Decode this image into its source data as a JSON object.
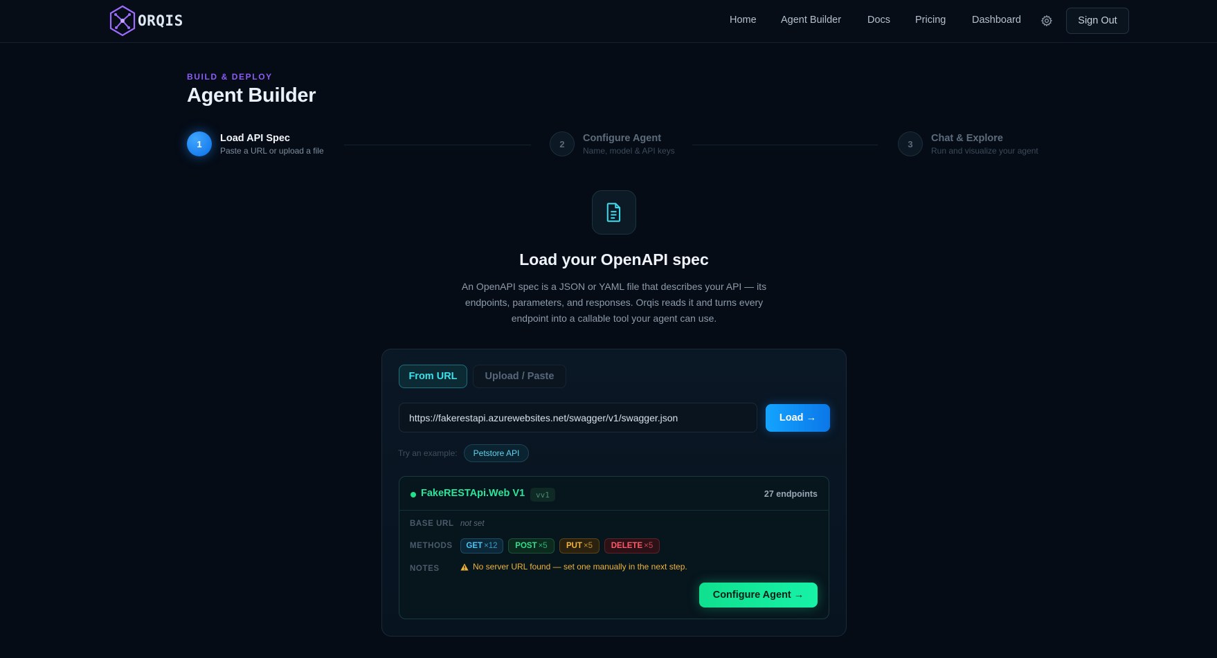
{
  "nav": {
    "brand": "ORQIS",
    "links": [
      "Home",
      "Agent Builder",
      "Docs",
      "Pricing",
      "Dashboard"
    ],
    "sign_out": "Sign Out"
  },
  "header": {
    "eyebrow": "BUILD & DEPLOY",
    "title": "Agent Builder"
  },
  "steps": [
    {
      "number": "1",
      "title": "Load API Spec",
      "subtitle": "Paste a URL or upload a file",
      "state": "active"
    },
    {
      "number": "2",
      "title": "Configure Agent",
      "subtitle": "Name, model & API keys",
      "state": "pending"
    },
    {
      "number": "3",
      "title": "Chat & Explore",
      "subtitle": "Run and visualize your agent",
      "state": "pending"
    }
  ],
  "hero": {
    "icon": "document-icon",
    "title": "Load your OpenAPI spec",
    "description": "An OpenAPI spec is a JSON or YAML file that describes your API — its endpoints, parameters, and responses. Orqis reads it and turns every endpoint into a callable tool your agent can use."
  },
  "loader": {
    "tabs": [
      "From URL",
      "Upload / Paste"
    ],
    "active_tab": "From URL",
    "url_value": "https://fakerestapi.azurewebsites.net/swagger/v1/swagger.json",
    "load_button": "Load →",
    "example_label": "Try an example:",
    "example_chip": "Petstore API"
  },
  "result": {
    "api_name": "FakeRESTApi.Web V1",
    "version": "vv1",
    "endpoint_count": "27 endpoints",
    "base_url_label": "BASE URL",
    "base_url_value": "not set",
    "methods_label": "METHODS",
    "methods": [
      {
        "name": "GET",
        "count": "×12"
      },
      {
        "name": "POST",
        "count": "×5"
      },
      {
        "name": "PUT",
        "count": "×5"
      },
      {
        "name": "DELETE",
        "count": "×5"
      }
    ],
    "notes_label": "NOTES",
    "note": "No server URL found — set one manually in the next step.",
    "configure_button": "Configure Agent →"
  },
  "colors": {
    "background": "#050c16",
    "accent_purple": "#8b5cf6",
    "accent_blue": "#14a4ff",
    "accent_green": "#17f2a7",
    "warning": "#f0b43a"
  }
}
